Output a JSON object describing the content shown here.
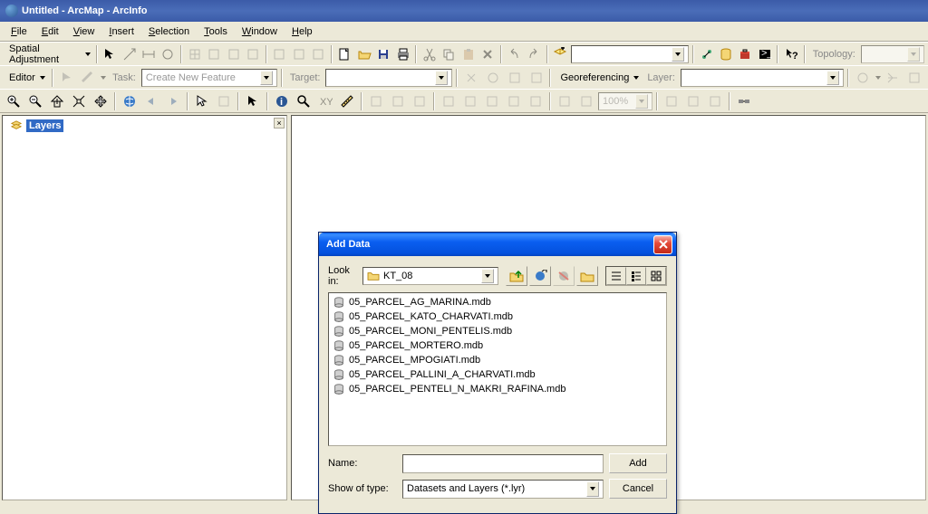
{
  "titlebar": {
    "title": "Untitled - ArcMap - ArcInfo"
  },
  "menubar": {
    "items": [
      "File",
      "Edit",
      "View",
      "Insert",
      "Selection",
      "Tools",
      "Window",
      "Help"
    ]
  },
  "toolbar1": {
    "spatial_label": "Spatial Adjustment"
  },
  "toolbar2": {
    "editor_label": "Editor",
    "task_label": "Task:",
    "task_value": "Create New Feature",
    "target_label": "Target:",
    "georef_label": "Georeferencing",
    "layer_label": "Layer:"
  },
  "toolbar3": {
    "zoom_value": "100%",
    "topology_label": "Topology:"
  },
  "toc": {
    "root_label": "Layers"
  },
  "dialog": {
    "title": "Add Data",
    "lookin_label": "Look in:",
    "lookin_value": "KT_08",
    "files": [
      "05_PARCEL_AG_MARINA.mdb",
      "05_PARCEL_KATO_CHARVATI.mdb",
      "05_PARCEL_MONI_PENTELIS.mdb",
      "05_PARCEL_MORTERO.mdb",
      "05_PARCEL_MPOGIATI.mdb",
      "05_PARCEL_PALLINI_A_CHARVATI.mdb",
      "05_PARCEL_PENTELI_N_MAKRI_RAFINA.mdb"
    ],
    "name_label": "Name:",
    "name_value": "",
    "showtype_label": "Show of type:",
    "showtype_value": "Datasets and Layers (*.lyr)",
    "add_btn": "Add",
    "cancel_btn": "Cancel"
  }
}
